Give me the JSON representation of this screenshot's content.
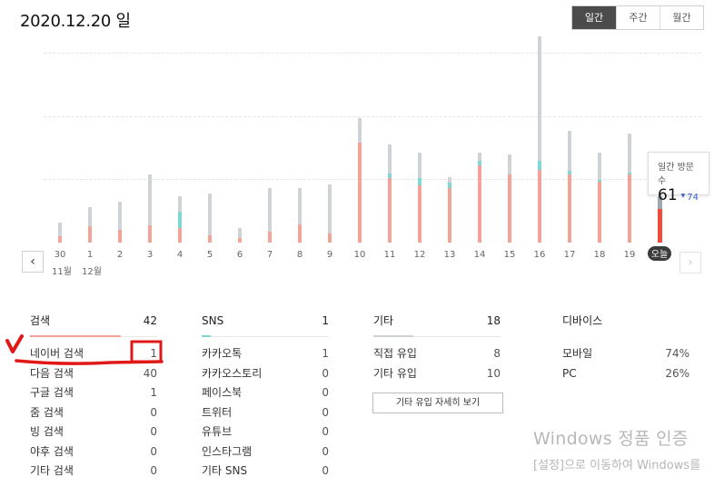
{
  "header": {
    "date_title": "2020.12.20 일"
  },
  "period_tabs": [
    {
      "label": "일간",
      "active": true
    },
    {
      "label": "주간",
      "active": false
    },
    {
      "label": "월간",
      "active": false
    }
  ],
  "chart_data": {
    "type": "bar",
    "categories": [
      "30",
      "1",
      "2",
      "3",
      "4",
      "5",
      "6",
      "7",
      "8",
      "9",
      "10",
      "11",
      "12",
      "13",
      "14",
      "15",
      "16",
      "17",
      "18",
      "19",
      "오늘"
    ],
    "series": [
      {
        "values": [
          7,
          18,
          14,
          19,
          16,
          8,
          5,
          12,
          20,
          10,
          110,
          71,
          63,
          60,
          85,
          75,
          80,
          75,
          67,
          75,
          37
        ]
      },
      {
        "values": [
          0,
          0,
          0,
          0,
          18,
          0,
          0,
          0,
          0,
          0,
          0,
          5,
          8,
          6,
          5,
          0,
          10,
          4,
          2,
          2,
          0
        ]
      },
      {
        "values": [
          15,
          21,
          31,
          56,
          17,
          46,
          11,
          48,
          40,
          54,
          27,
          32,
          28,
          6,
          9,
          22,
          142,
          44,
          30,
          43,
          14
        ]
      }
    ],
    "series_colors": [
      "#f4a398",
      "#7fd8d4",
      "#cfd3d6"
    ],
    "today_colors": [
      "#ee4b3c",
      "#a0a6ad"
    ],
    "month_labels": [
      {
        "text": "11월",
        "at": "30"
      },
      {
        "text": "12월",
        "at": "1"
      }
    ],
    "grid": true
  },
  "tooltip": {
    "label": "일간 방문수",
    "value": "61",
    "prev_value": "74"
  },
  "nav": {
    "prev_icon": "‹",
    "next_icon": "›"
  },
  "stats": {
    "search": {
      "title": "검색",
      "total": "42",
      "rows": [
        {
          "label": "네이버 검색",
          "value": "1"
        },
        {
          "label": "다음 검색",
          "value": "40"
        },
        {
          "label": "구글 검색",
          "value": "1"
        },
        {
          "label": "줌 검색",
          "value": "0"
        },
        {
          "label": "빙 검색",
          "value": "0"
        },
        {
          "label": "야후 검색",
          "value": "0"
        },
        {
          "label": "기타 검색",
          "value": "0"
        }
      ]
    },
    "sns": {
      "title": "SNS",
      "total": "1",
      "rows": [
        {
          "label": "카카오톡",
          "value": "1"
        },
        {
          "label": "카카오스토리",
          "value": "0"
        },
        {
          "label": "페이스북",
          "value": "0"
        },
        {
          "label": "트위터",
          "value": "0"
        },
        {
          "label": "유튜브",
          "value": "0"
        },
        {
          "label": "인스타그램",
          "value": "0"
        },
        {
          "label": "기타 SNS",
          "value": "0"
        }
      ]
    },
    "etc": {
      "title": "기타",
      "total": "18",
      "rows": [
        {
          "label": "직접 유입",
          "value": "8"
        },
        {
          "label": "기타 유입",
          "value": "10"
        }
      ],
      "detail_button": "기타 유입 자세히 보기"
    },
    "device": {
      "title": "디바이스",
      "rows": [
        {
          "label": "모바일",
          "value": "74%"
        },
        {
          "label": "PC",
          "value": "26%"
        }
      ]
    }
  },
  "accent_colors": {
    "search": "#f4a398",
    "sns": "#7fd8d4",
    "etc": "#cfd3d6",
    "annotation": "#e01818"
  },
  "activation": {
    "title": "Windows 정품 인증",
    "subtitle": "[설정]으로 이동하여 Windows를"
  }
}
